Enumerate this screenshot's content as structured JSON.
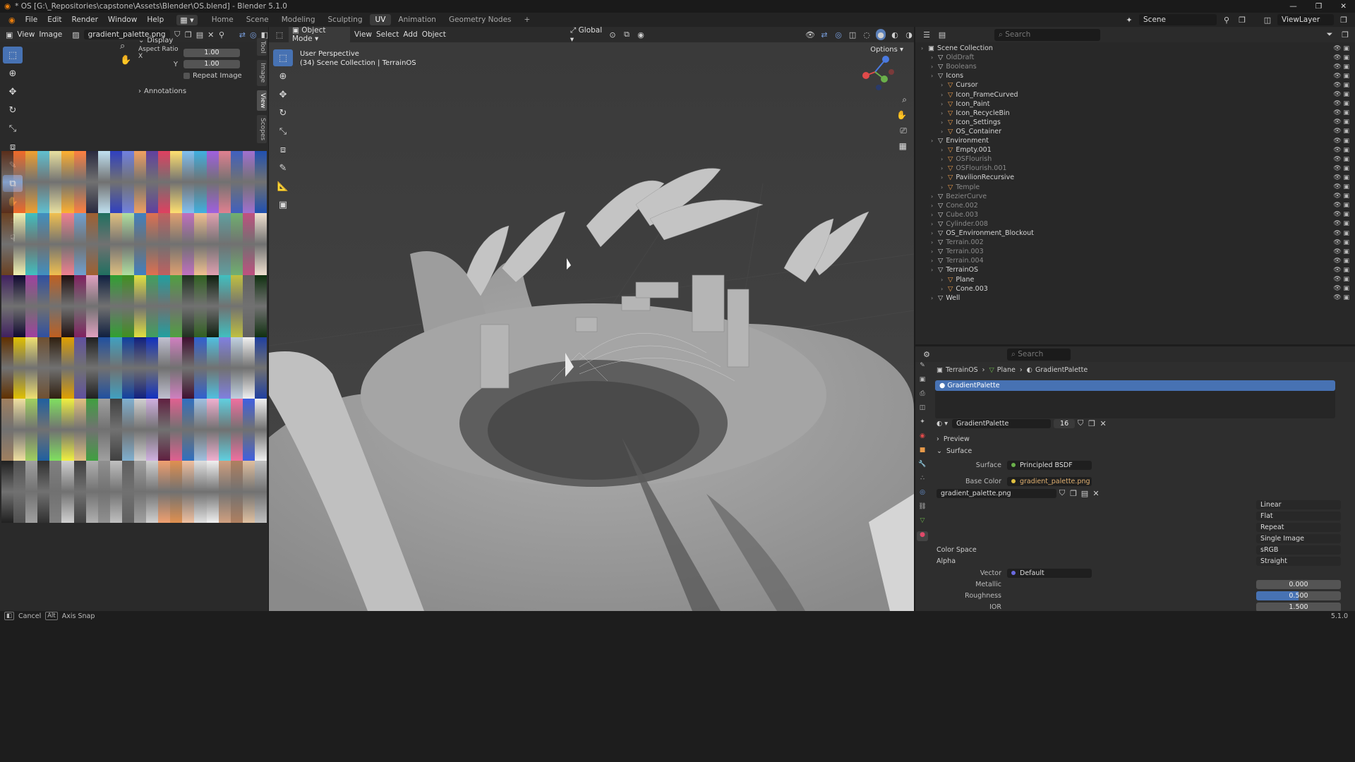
{
  "window": {
    "title": "* OS [G:\\_Repositories\\capstone\\Assets\\Blender\\OS.blend] - Blender 5.1.0",
    "controls": [
      "—",
      "❐",
      "✕"
    ]
  },
  "menubar": {
    "menus": [
      "File",
      "Edit",
      "Render",
      "Window",
      "Help"
    ],
    "workspaces": [
      "Home",
      "Scene",
      "Modeling",
      "Sculpting",
      "UV",
      "Animation",
      "Geometry Nodes"
    ],
    "active_workspace": "UV",
    "add_symbol": "+",
    "scene_name": "Scene",
    "view_layer": "ViewLayer"
  },
  "image_editor": {
    "menus": [
      "View",
      "Image"
    ],
    "image_name": "gradient_palette.png",
    "display": {
      "section": "Display",
      "aspect_label": "Aspect Ratio X",
      "aspect_x": "1.00",
      "y_label": "Y",
      "aspect_y": "1.00",
      "repeat_label": "Repeat Image",
      "annotations": "Annotations"
    },
    "tabs": [
      "Tool",
      "Image",
      "View",
      "Scopes"
    ],
    "active_tab": "View"
  },
  "palette_colors": [
    [
      "#5a2e1a",
      "#f06a28",
      "#f0a030",
      "#60c0d0",
      "#e8e0a0",
      "#ffb030",
      "#ff8040",
      "#2a2a40",
      "#c0e0f0",
      "#3040c0",
      "#7080e0",
      "#f0a060",
      "#6040a0",
      "#e04060",
      "#ffe070",
      "#80c0f0",
      "#40b0e0",
      "#a060e0",
      "#e08090",
      "#4060c0",
      "#a070d0",
      "#2050b0"
    ],
    [
      "#6a4020",
      "#f0f0b0",
      "#40c0c0",
      "#4090c0",
      "#f0c050",
      "#f08090",
      "#70a0d0",
      "#a06030",
      "#207060",
      "#e0c080",
      "#b0e0a0",
      "#4080c0",
      "#e07050",
      "#c06060",
      "#e0a070",
      "#c070c0",
      "#f0c090",
      "#e0a0b0",
      "#60a0a0",
      "#70b070",
      "#c05080",
      "#f0e0d0"
    ],
    [
      "#402060",
      "#100830",
      "#a040a0",
      "#3050a0",
      "#c06020",
      "#201010",
      "#802060",
      "#e0a0c0",
      "#102040",
      "#30a030",
      "#409020",
      "#e0e040",
      "#40a060",
      "#20a0a0",
      "#50a040",
      "#203020",
      "#306020",
      "#102010",
      "#40c0c0",
      "#c0c040",
      "#606060",
      "#103010"
    ],
    [
      "#603000",
      "#e0c000",
      "#f0e070",
      "#705030",
      "#302010",
      "#e0a000",
      "#6050a0",
      "#202020",
      "#2050a0",
      "#40a0c0",
      "#1040a0",
      "#102080",
      "#1030c0",
      "#c0c0d0",
      "#d080c0",
      "#401030",
      "#3060d0",
      "#50c0e0",
      "#8080e0",
      "#c0d0e0",
      "#f0f0f0",
      "#2040a0"
    ],
    [
      "#a08060",
      "#f0e0a0",
      "#a0d060",
      "#2060a0",
      "#80e060",
      "#f0f040",
      "#e0c080",
      "#40a040",
      "#a0a0a0",
      "#404040",
      "#80b0d0",
      "#d0d0d0",
      "#d0b0e0",
      "#602040",
      "#e06090",
      "#3070c0",
      "#a0c0e0",
      "#f0b0d0",
      "#60d0e0",
      "#f070a0",
      "#4060e0",
      "#f0f0f0"
    ],
    [
      "#202020",
      "#505050",
      "#a0a0a0",
      "#303030",
      "#808080",
      "#d0d0d0",
      "#404040",
      "#b0b0b0",
      "#909090",
      "#c0c0c0",
      "#606060",
      "#a0a0a0",
      "#d0d0d0",
      "#f0a070",
      "#e09050",
      "#f0c0a0",
      "#e0e0e0",
      "#f0f0f0",
      "#d0a080",
      "#b08060",
      "#e0c0a0",
      "#c0c0c0"
    ]
  ],
  "viewport": {
    "mode": "Object Mode",
    "menus": [
      "View",
      "Select",
      "Add",
      "Object"
    ],
    "orientation": "Global",
    "options": "Options",
    "view_name": "User Perspective",
    "collection_info": "(34) Scene Collection | TerrainOS"
  },
  "outliner": {
    "search_placeholder": "Search",
    "items": [
      {
        "name": "Scene Collection",
        "depth": 0,
        "dim": false
      },
      {
        "name": "OldDraft",
        "depth": 1,
        "dim": true
      },
      {
        "name": "Booleans",
        "depth": 1,
        "dim": true
      },
      {
        "name": "Icons",
        "depth": 1,
        "dim": false
      },
      {
        "name": "Cursor",
        "depth": 2,
        "dim": false
      },
      {
        "name": "Icon_FrameCurved",
        "depth": 2,
        "dim": false
      },
      {
        "name": "Icon_Paint",
        "depth": 2,
        "dim": false
      },
      {
        "name": "Icon_RecycleBin",
        "depth": 2,
        "dim": false
      },
      {
        "name": "Icon_Settings",
        "depth": 2,
        "dim": false
      },
      {
        "name": "OS_Container",
        "depth": 2,
        "dim": false
      },
      {
        "name": "Environment",
        "depth": 1,
        "dim": false
      },
      {
        "name": "Empty.001",
        "depth": 2,
        "dim": false
      },
      {
        "name": "OSFlourish",
        "depth": 2,
        "dim": true
      },
      {
        "name": "OSFlourish.001",
        "depth": 2,
        "dim": true
      },
      {
        "name": "PavilionRecursive",
        "depth": 2,
        "dim": false
      },
      {
        "name": "Temple",
        "depth": 2,
        "dim": true
      },
      {
        "name": "BezierCurve",
        "depth": 1,
        "dim": true
      },
      {
        "name": "Cone.002",
        "depth": 1,
        "dim": true
      },
      {
        "name": "Cube.003",
        "depth": 1,
        "dim": true
      },
      {
        "name": "Cylinder.008",
        "depth": 1,
        "dim": true
      },
      {
        "name": "OS_Environment_Blockout",
        "depth": 1,
        "dim": false
      },
      {
        "name": "Terrain.002",
        "depth": 1,
        "dim": true
      },
      {
        "name": "Terrain.003",
        "depth": 1,
        "dim": true
      },
      {
        "name": "Terrain.004",
        "depth": 1,
        "dim": true
      },
      {
        "name": "TerrainOS",
        "depth": 1,
        "dim": false
      },
      {
        "name": "Plane",
        "depth": 2,
        "dim": false
      },
      {
        "name": "Cone.003",
        "depth": 2,
        "dim": false
      },
      {
        "name": "Well",
        "depth": 1,
        "dim": false
      }
    ]
  },
  "properties": {
    "search_placeholder": "Search",
    "breadcrumb": [
      "TerrainOS",
      "Plane",
      "GradientPalette"
    ],
    "material_slot": "GradientPalette",
    "material_name": "GradientPalette",
    "users": "16",
    "sections": {
      "preview": "Preview",
      "surface": "Surface"
    },
    "surface_label": "Surface",
    "surface_value": "Principled BSDF",
    "base_color_label": "Base Color",
    "base_color_value": "gradient_palette.png",
    "image_name": "gradient_palette.png",
    "interpolation": "Linear",
    "projection": "Flat",
    "extension": "Repeat",
    "source": "Single Image",
    "color_space_label": "Color Space",
    "color_space": "sRGB",
    "alpha_label": "Alpha",
    "alpha": "Straight",
    "vector_label": "Vector",
    "vector": "Default",
    "metallic_label": "Metallic",
    "metallic": "0.000",
    "roughness_label": "Roughness",
    "roughness": "0.500",
    "roughness_fraction": 0.5,
    "ior_label": "IOR",
    "ior": "1.500"
  },
  "status": {
    "cancel": "Cancel",
    "alt_key": "Alt",
    "axis_snap": "Axis Snap",
    "version": "5.1.0"
  }
}
